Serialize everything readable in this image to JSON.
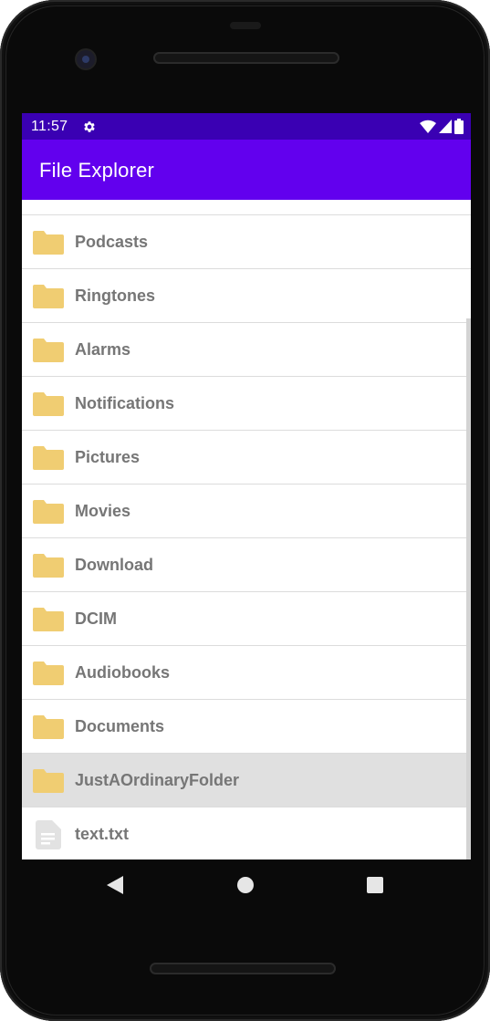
{
  "status_bar": {
    "time": "11:57",
    "icons": [
      "settings-icon",
      "wifi-icon",
      "signal-icon",
      "battery-icon"
    ],
    "background": "#3a00b3"
  },
  "app_bar": {
    "title": "File Explorer",
    "background": "#6200ee"
  },
  "file_list": {
    "folder_color": "#f0cd72",
    "items": [
      {
        "label": "Podcasts",
        "type": "folder"
      },
      {
        "label": "Ringtones",
        "type": "folder"
      },
      {
        "label": "Alarms",
        "type": "folder"
      },
      {
        "label": "Notifications",
        "type": "folder"
      },
      {
        "label": "Pictures",
        "type": "folder"
      },
      {
        "label": "Movies",
        "type": "folder"
      },
      {
        "label": "Download",
        "type": "folder"
      },
      {
        "label": "DCIM",
        "type": "folder"
      },
      {
        "label": "Audiobooks",
        "type": "folder"
      },
      {
        "label": "Documents",
        "type": "folder"
      },
      {
        "label": "JustAOrdinaryFolder",
        "type": "folder",
        "selected": true
      },
      {
        "label": "text.txt",
        "type": "file"
      }
    ]
  },
  "navigation_bar": {
    "buttons": [
      "back-icon",
      "home-icon",
      "recents-icon"
    ]
  }
}
